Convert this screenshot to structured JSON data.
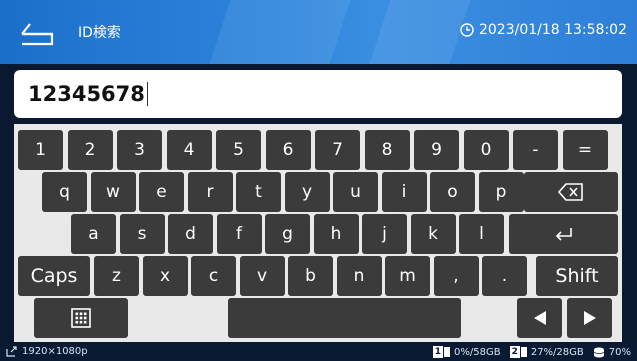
{
  "header": {
    "title": "ID検索",
    "datetime": "2023/01/18 13:58:02"
  },
  "input": {
    "value": "12345678"
  },
  "keyboard": {
    "row1": [
      "1",
      "2",
      "3",
      "4",
      "5",
      "6",
      "7",
      "8",
      "9",
      "0",
      "-",
      "="
    ],
    "row2": [
      "q",
      "w",
      "e",
      "r",
      "t",
      "y",
      "u",
      "i",
      "o",
      "p"
    ],
    "row3": [
      "a",
      "s",
      "d",
      "f",
      "g",
      "h",
      "j",
      "k",
      "l"
    ],
    "row4": [
      "z",
      "x",
      "c",
      "v",
      "b",
      "n",
      "m",
      ",",
      "."
    ],
    "caps_label": "Caps",
    "shift_label": "Shift",
    "backspace_icon": "backspace-icon",
    "enter_icon": "enter-icon",
    "layout_icon": "keypad-icon",
    "left_icon": "arrow-left-icon",
    "right_icon": "arrow-right-icon"
  },
  "status": {
    "resolution": "1920×1080p",
    "disk1_num": "1",
    "disk1_usage": "0%/58GB",
    "disk2_num": "2",
    "disk2_usage": "27%/28GB",
    "db_usage": "70%"
  },
  "colors": {
    "header_blue": "#2f86dd",
    "key_bg": "#3b3b3b",
    "keyboard_bg": "#e9e9e9"
  }
}
